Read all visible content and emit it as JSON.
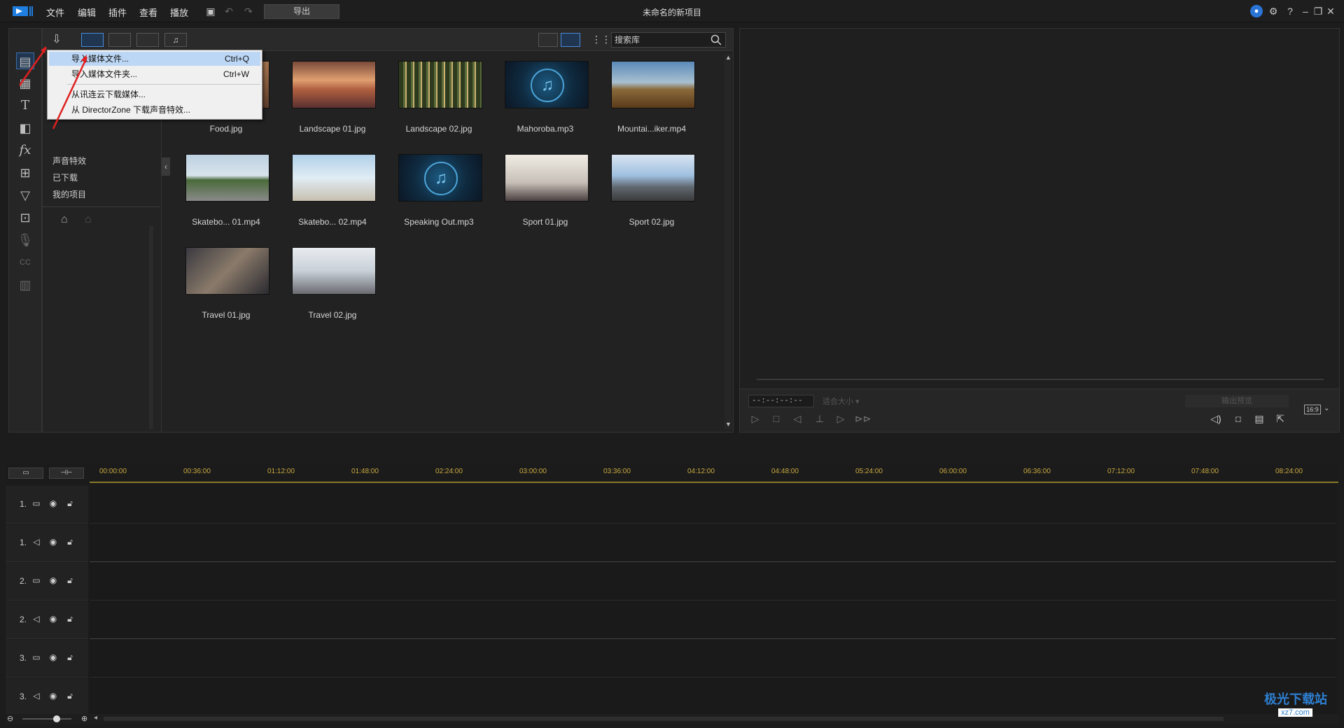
{
  "titlebar": {
    "menus": [
      "文件",
      "编辑",
      "插件",
      "查看",
      "播放"
    ],
    "export_label": "导出",
    "window_title": "未命名的新项目",
    "icons": [
      "save-icon",
      "undo-icon",
      "redo-icon",
      "account-icon",
      "settings-icon",
      "help-icon",
      "minimize-icon",
      "restore-icon",
      "close-icon"
    ]
  },
  "library": {
    "search_placeholder": "搜索库",
    "categories": [
      "声音特效",
      "已下载",
      "我的项目"
    ],
    "media": [
      {
        "name": "Food.jpg",
        "type": "image"
      },
      {
        "name": "Landscape 01.jpg",
        "type": "image"
      },
      {
        "name": "Landscape 02.jpg",
        "type": "image"
      },
      {
        "name": "Mahoroba.mp3",
        "type": "audio"
      },
      {
        "name": "Mountai...iker.mp4",
        "type": "video"
      },
      {
        "name": "Skatebo... 01.mp4",
        "type": "video"
      },
      {
        "name": "Skatebo... 02.mp4",
        "type": "video"
      },
      {
        "name": "Speaking Out.mp3",
        "type": "audio"
      },
      {
        "name": "Sport 01.jpg",
        "type": "image"
      },
      {
        "name": "Sport 02.jpg",
        "type": "image"
      },
      {
        "name": "Travel 01.jpg",
        "type": "image"
      },
      {
        "name": "Travel 02.jpg",
        "type": "image"
      }
    ]
  },
  "dropdown": {
    "items": [
      {
        "label": "导入媒体文件...",
        "shortcut": "Ctrl+Q",
        "highlighted": true
      },
      {
        "label": "导入媒体文件夹...",
        "shortcut": "Ctrl+W"
      },
      {
        "label": "从讯连云下载媒体...",
        "shortcut": ""
      },
      {
        "label": "从 DirectorZone 下载声音特效...",
        "shortcut": ""
      }
    ]
  },
  "preview": {
    "timecode": "--:--:--:--",
    "fit_label": "适合大小",
    "output_label": "输出预览",
    "aspect": "16:9"
  },
  "timeline": {
    "ticks": [
      "00:00:00",
      "00:36:00",
      "01:12:00",
      "01:48:00",
      "02:24:00",
      "03:00:00",
      "03:36:00",
      "04:12:00",
      "04:48:00",
      "05:24:00",
      "06:00:00",
      "06:36:00",
      "07:12:00",
      "07:48:00",
      "08:24:00"
    ],
    "tracks": [
      {
        "label": "1.",
        "kind": "video"
      },
      {
        "label": "1.",
        "kind": "audio"
      },
      {
        "label": "2.",
        "kind": "video"
      },
      {
        "label": "2.",
        "kind": "audio"
      },
      {
        "label": "3.",
        "kind": "video"
      },
      {
        "label": "3.",
        "kind": "audio"
      }
    ]
  },
  "watermark": {
    "text": "极光下载站",
    "url": "xz7.com"
  },
  "colors": {
    "accent": "#4a8ad9",
    "ruler": "#c8a93f",
    "arrow": "#e02020"
  }
}
